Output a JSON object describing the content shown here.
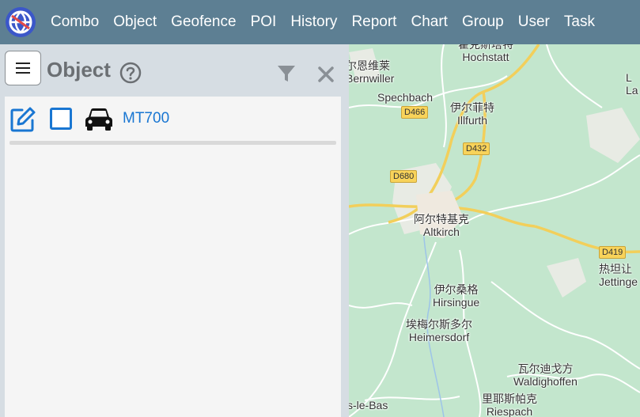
{
  "nav": {
    "items": [
      "Combo",
      "Object",
      "Geofence",
      "POI",
      "History",
      "Report",
      "Chart",
      "Group",
      "User",
      "Task"
    ]
  },
  "panel": {
    "title": "Object",
    "objects": [
      {
        "name": "MT700"
      }
    ]
  },
  "map": {
    "places": [
      {
        "zh": "霍克斯塔特",
        "name": "Hochstatt"
      },
      {
        "zh": "尔恩维莱",
        "name": "Bernwiller"
      },
      {
        "zh": "",
        "name": "Spechbach"
      },
      {
        "zh": "伊尔菲特",
        "name": "Illfurth"
      },
      {
        "zh": "阿尔特基克",
        "name": "Altkirch"
      },
      {
        "zh": "伊尔桑格",
        "name": "Hirsingue"
      },
      {
        "zh": "埃梅尔斯多尔",
        "name": "Heimersdorf"
      },
      {
        "zh": "瓦尔迪戈方",
        "name": "Waldighoffen"
      },
      {
        "zh": "里耶斯帕克",
        "name": "Riespach"
      },
      {
        "zh": "热坦让",
        "name": "Jettinge"
      },
      {
        "zh": "",
        "name": "s-le-Bas"
      },
      {
        "zh": "L",
        "name": "La"
      }
    ],
    "roads": [
      "D466",
      "D432",
      "D680",
      "D419"
    ]
  }
}
